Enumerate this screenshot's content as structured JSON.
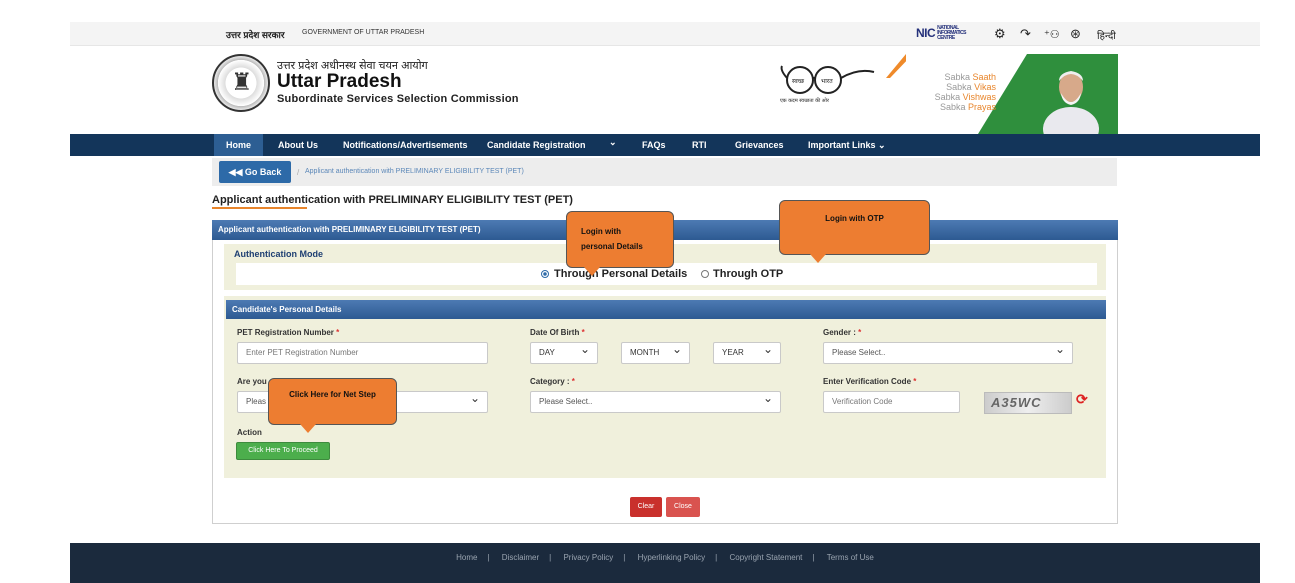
{
  "topbar": {
    "hindi_gov": "उत्तर प्रदेश सरकार",
    "gov_en": "GOVERNMENT OF UTTAR PRADESH",
    "nic_logo": "NIC",
    "nic_sub": "NATIONAL INFORMATICS CENTRE",
    "lang": "हिन्दी",
    "icons": [
      "gear-icon",
      "audio-icon",
      "sitemap-icon",
      "accessibility-icon"
    ]
  },
  "header": {
    "hindi_name": "उत्तर प्रदेश अधीनस्थ सेवा चयन आयोग",
    "title": "Uttar Pradesh",
    "subtitle": "Subordinate Services Selection Commission",
    "glasses_caption": "एक कदम स्वच्छता की ओर",
    "glasses_left": "स्वच्छ",
    "glasses_right": "भारत",
    "banner_lines": [
      {
        "pre": "Sabka ",
        "hl": "Saath"
      },
      {
        "pre": "Sabka ",
        "hl": "Vikas"
      },
      {
        "pre": "Sabka ",
        "hl": "Vishwas"
      },
      {
        "pre": "Sabka ",
        "hl": "Prayas"
      }
    ]
  },
  "nav": {
    "items": [
      "Home",
      "About Us",
      "Notifications/Advertisements",
      "Candidate Registration",
      "⌄",
      "FAQs",
      "RTI",
      "Grievances",
      "Important Links ⌄"
    ]
  },
  "breadcrumb": {
    "back": "◀◀ Go Back",
    "sep": "/",
    "current": "Applicant authentication with PRELIMINARY ELIGIBILITY TEST (PET)"
  },
  "page": {
    "title": "Applicant authentication with PRELIMINARY ELIGIBILITY TEST (PET)",
    "panel_title": "Applicant authentication with PRELIMINARY ELIGIBILITY TEST (PET)"
  },
  "auth": {
    "label": "Authentication Mode",
    "option_personal": "Through Personal Details",
    "option_otp": "Through OTP",
    "selected": "personal"
  },
  "details": {
    "heading": "Candidate's Personal Details",
    "pet_label": "PET Registration Number",
    "pet_placeholder": "Enter PET Registration Number",
    "dob_label": "Date Of Birth",
    "dob_day": "DAY",
    "dob_month": "MONTH",
    "dob_year": "YEAR",
    "gender_label": "Gender :",
    "gender_value": "Please Select..",
    "domicile_label": "Are you",
    "domicile_value": "Pleas",
    "category_label": "Category :",
    "category_value": "Please Select..",
    "verify_label": "Enter Verification Code",
    "verify_placeholder": "Verification Code",
    "captcha": "A35WC",
    "required_mark": "*",
    "action_label": "Action",
    "proceed": "Click Here To Proceed"
  },
  "buttons": {
    "clear": "Clear",
    "close": "Close"
  },
  "callouts": {
    "personal_line1": "Login with",
    "personal_line2": "personal Details",
    "otp": "Login with OTP",
    "next": "Click Here for Net Step"
  },
  "footer": {
    "links": [
      "Home",
      "Disclaimer",
      "Privacy Policy",
      "Hyperlinking Policy",
      "Copyright Statement",
      "Terms of Use"
    ],
    "sep": "|"
  },
  "colors": {
    "nav": "#13355a",
    "panel_head": "#2d5a92",
    "form_bg": "#f0f0dc",
    "callout": "#ed7d31",
    "proceed": "#4cae4c",
    "clear": "#c9302c",
    "close": "#d9534f",
    "footer": "#1b2a3d"
  }
}
